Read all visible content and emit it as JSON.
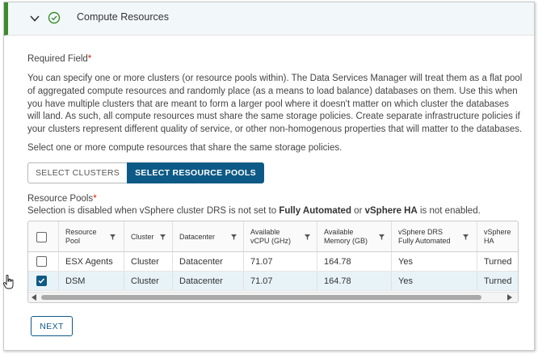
{
  "panel": {
    "title": "Compute Resources",
    "colors": {
      "accent_bar": "#3e8a2d",
      "primary": "#0e5a86",
      "required_star": "#c92100"
    }
  },
  "form": {
    "required_label": "Required Field",
    "required_star": "*",
    "description": "You can specify one or more clusters (or resource pools within). The Data Services Manager will treat them as a flat pool of aggregated compute resources and randomly place (as a means to load balance) databases on them. Use this when you have multiple clusters that are meant to form a larger pool where it doesn't matter on which cluster the databases will land. As such, all compute resources must share the same storage policies. Create separate infrastructure policies if your clusters represent different quality of service, or other non-homogenous properties that will matter to the databases.",
    "select_instruction": "Select one or more compute resources that share the same storage policies.",
    "toggle": {
      "clusters_label": "SELECT CLUSTERS",
      "resource_pools_label": "SELECT RESOURCE POOLS",
      "selected": "SELECT RESOURCE POOLS"
    },
    "resource_pools_label": "Resource Pools",
    "resource_pools_star": "*",
    "note_prefix": "Selection is disabled when vSphere cluster DRS is not set to ",
    "note_bold1": "Fully Automated",
    "note_mid": " or ",
    "note_bold2": "vSphere HA",
    "note_suffix": " is not enabled.",
    "next_label": "NEXT"
  },
  "table": {
    "headers": {
      "resource_pool": [
        "Resource",
        "Pool"
      ],
      "cluster": "Cluster",
      "datacenter": "Datacenter",
      "cpu": [
        "Available",
        "vCPU (GHz)"
      ],
      "memory": [
        "Available",
        "Memory (GB)"
      ],
      "drs": [
        "vSphere DRS",
        "Fully Automated"
      ],
      "ha": [
        "vSphere",
        "HA"
      ]
    },
    "rows": [
      {
        "selected": false,
        "resource_pool": "ESX Agents",
        "cluster": "Cluster",
        "datacenter": "Datacenter",
        "cpu": "71.07",
        "memory": "164.78",
        "drs": "Yes",
        "ha": "Turned"
      },
      {
        "selected": true,
        "resource_pool": "DSM",
        "cluster": "Cluster",
        "datacenter": "Datacenter",
        "cpu": "71.07",
        "memory": "164.78",
        "drs": "Yes",
        "ha": "Turned"
      }
    ]
  },
  "icons": {
    "expand": "chevron-down-icon",
    "status": "check-circle-icon",
    "filter": "filter-icon",
    "cursor": "hand-pointer-icon"
  }
}
